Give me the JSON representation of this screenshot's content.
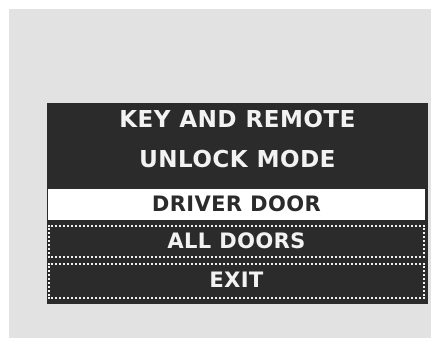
{
  "menu": {
    "title_line1": "KEY AND REMOTE",
    "title_line2": "UNLOCK MODE",
    "options": [
      {
        "label": "DRIVER DOOR",
        "selected": true
      },
      {
        "label": "ALL DOORS",
        "selected": false
      },
      {
        "label": "EXIT",
        "selected": false
      }
    ]
  },
  "colors": {
    "screen_background": "#2b2b2b",
    "text": "#f2f2f2",
    "selection_background": "#ffffff",
    "outer_panel": "#e2e2e2"
  }
}
